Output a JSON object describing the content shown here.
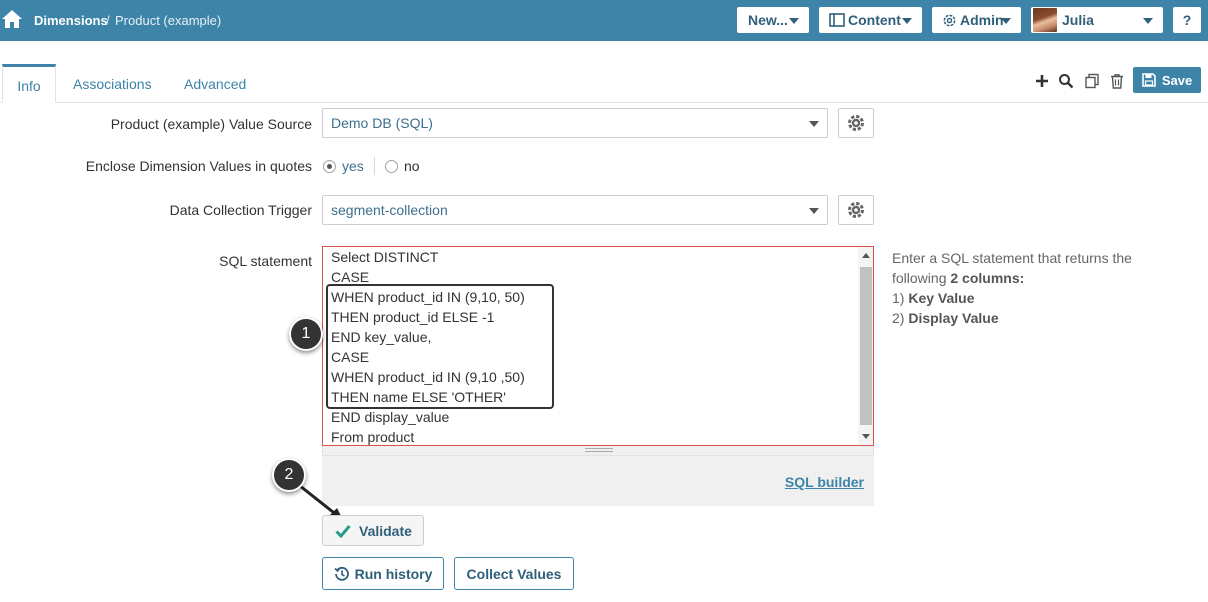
{
  "header": {
    "breadcrumb_root": "Dimensions",
    "breadcrumb_separator": "/",
    "breadcrumb_current": "Product (example)",
    "new_label": "New...",
    "content_label": "Content",
    "admin_label": "Admin",
    "user_name": "Julia",
    "help_label": "?"
  },
  "tabs": [
    {
      "label": "Info",
      "active": true
    },
    {
      "label": "Associations",
      "active": false
    },
    {
      "label": "Advanced",
      "active": false
    }
  ],
  "toolbar": {
    "save_label": "Save",
    "icons": [
      "plus-icon",
      "search-icon",
      "copy-icon",
      "trash-icon",
      "save-icon"
    ]
  },
  "form": {
    "value_source_label": "Product (example) Value Source",
    "value_source_value": "Demo DB (SQL)",
    "enclose_label": "Enclose Dimension Values in quotes",
    "enclose_yes": "yes",
    "enclose_no": "no",
    "enclose_selected": "yes",
    "trigger_label": "Data Collection Trigger",
    "trigger_value": "segment-collection",
    "sql_label": "SQL statement",
    "sql_lines": [
      "Select DISTINCT",
      "CASE",
      "WHEN product_id IN (9,10, 50)",
      "THEN product_id ELSE -1",
      "END key_value,",
      "CASE",
      "WHEN product_id IN (9,10 ,50)",
      "THEN name ELSE 'OTHER'",
      "END display_value",
      "From product"
    ],
    "sql_builder_label": "SQL builder",
    "hint_line1": "Enter a SQL statement that returns the",
    "hint_line2_prefix": "following ",
    "hint_line2_bold": "2 columns:",
    "hint_item1_prefix": "1) ",
    "hint_item1": "Key Value",
    "hint_item2_prefix": "2) ",
    "hint_item2": "Display Value"
  },
  "actions": {
    "validate_label": "Validate",
    "run_history_label": "Run history",
    "collect_values_label": "Collect Values"
  },
  "annotations": {
    "badge_1": "1",
    "badge_2": "2"
  },
  "colors": {
    "header_bg": "#3d84a8",
    "accent": "#3d84a8",
    "error_border": "#d9534f",
    "validate_check": "#2a9a8c"
  }
}
